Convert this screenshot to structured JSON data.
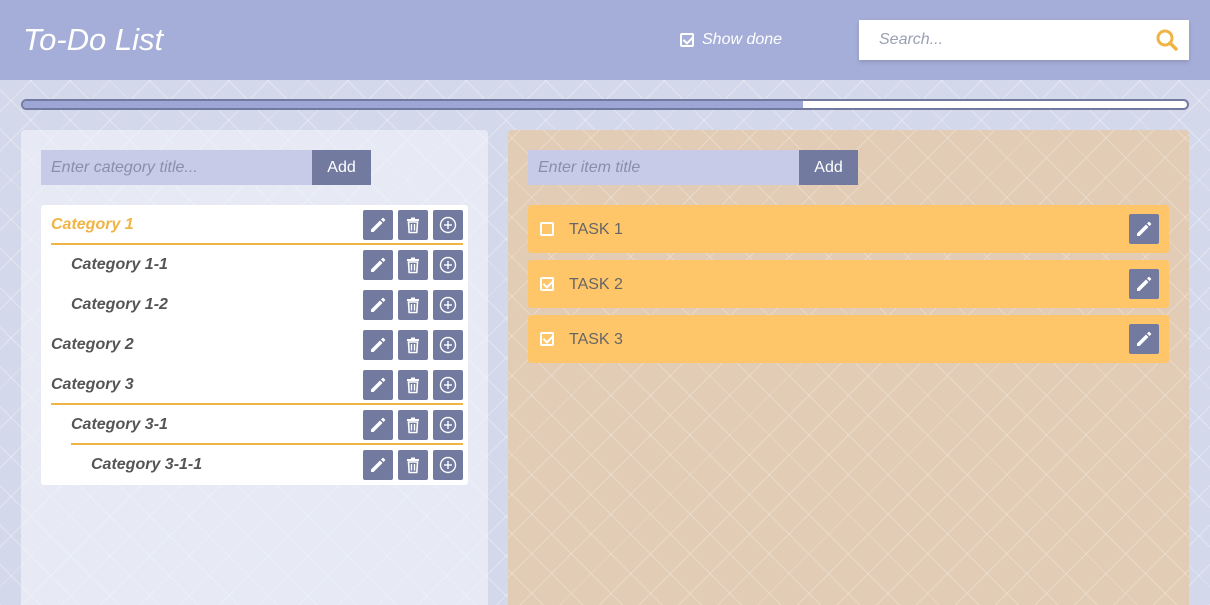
{
  "header": {
    "title": "To-Do List",
    "show_done_label": "Show done",
    "show_done_checked": true,
    "search_placeholder": "Search..."
  },
  "progress": {
    "fraction": 0.67
  },
  "categories_panel": {
    "input_placeholder": "Enter category title...",
    "add_label": "Add",
    "items": [
      {
        "label": "Category 1",
        "level": 0,
        "active": true,
        "underline": true
      },
      {
        "label": "Category 1-1",
        "level": 1,
        "active": false,
        "underline": false
      },
      {
        "label": "Category 1-2",
        "level": 1,
        "active": false,
        "underline": false
      },
      {
        "label": "Category 2",
        "level": 0,
        "active": false,
        "underline": false
      },
      {
        "label": "Category 3",
        "level": 0,
        "active": false,
        "underline": true
      },
      {
        "label": "Category 3-1",
        "level": 1,
        "active": false,
        "underline": true
      },
      {
        "label": "Category 3-1-1",
        "level": 2,
        "active": false,
        "underline": false
      }
    ]
  },
  "tasks_panel": {
    "input_placeholder": "Enter item title",
    "add_label": "Add",
    "tasks": [
      {
        "label": "TASK 1",
        "done": false
      },
      {
        "label": "TASK 2",
        "done": true
      },
      {
        "label": "TASK 3",
        "done": true
      }
    ]
  },
  "colors": {
    "header_bg": "#a5aed8",
    "button_bg": "#727aa0",
    "accent": "#f0b445",
    "task_bg": "#fec569"
  },
  "icons": {
    "edit": "pencil-icon",
    "delete": "trash-icon",
    "add": "plus-circle-icon",
    "search": "magnifier-icon"
  }
}
